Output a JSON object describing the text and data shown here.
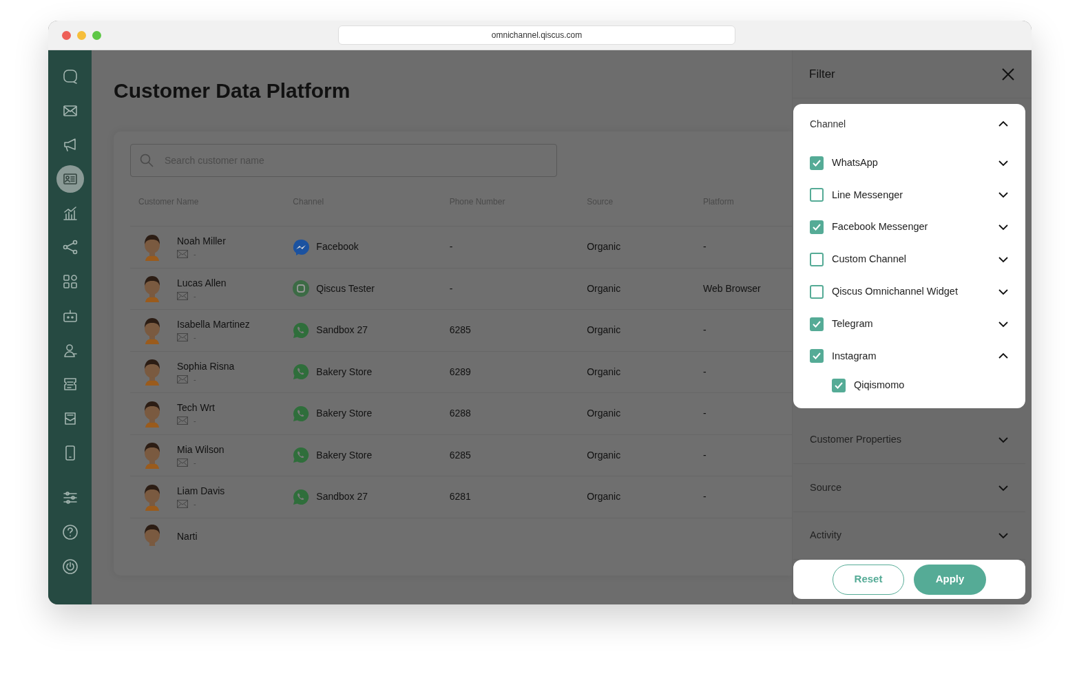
{
  "browser": {
    "url": "omnichannel.qiscus.com"
  },
  "sidebar": {
    "items": [
      {
        "selected": false
      },
      {
        "selected": false
      },
      {
        "selected": false
      },
      {
        "selected": true
      },
      {
        "selected": false
      },
      {
        "selected": false
      },
      {
        "selected": false
      },
      {
        "selected": false
      },
      {
        "selected": false
      },
      {
        "selected": false
      },
      {
        "selected": false
      },
      {
        "selected": false
      },
      {
        "selected": false
      },
      {
        "selected": false
      },
      {
        "selected": false
      }
    ]
  },
  "page": {
    "title": "Customer Data Platform"
  },
  "search": {
    "placeholder": "Search customer name"
  },
  "table": {
    "columns": [
      "Customer Name",
      "Channel",
      "Phone Number",
      "Source",
      "Platform"
    ],
    "rows": [
      {
        "name": "Noah Miller",
        "email": "-",
        "channel": {
          "kind": "messenger",
          "name": "Facebook"
        },
        "phone": "-",
        "source": "Organic",
        "platform": "-"
      },
      {
        "name": "Lucas Allen",
        "email": "-",
        "channel": {
          "kind": "qiscus",
          "name": "Qiscus Tester"
        },
        "phone": "-",
        "source": "Organic",
        "platform": "Web Browser"
      },
      {
        "name": "Isabella Martinez",
        "email": "-",
        "channel": {
          "kind": "whatsapp",
          "name": "Sandbox 27"
        },
        "phone": "6285",
        "source": "Organic",
        "platform": "-"
      },
      {
        "name": "Sophia Risna",
        "email": "-",
        "channel": {
          "kind": "whatsapp",
          "name": "Bakery Store"
        },
        "phone": "6289",
        "source": "Organic",
        "platform": "-"
      },
      {
        "name": "Tech Wrt",
        "email": "-",
        "channel": {
          "kind": "whatsapp",
          "name": "Bakery Store"
        },
        "phone": "6288",
        "source": "Organic",
        "platform": "-"
      },
      {
        "name": "Mia Wilson",
        "email": "-",
        "channel": {
          "kind": "whatsapp",
          "name": "Bakery Store"
        },
        "phone": "6285",
        "source": "Organic",
        "platform": "-"
      },
      {
        "name": "Liam Davis",
        "email": "-",
        "channel": {
          "kind": "whatsapp",
          "name": "Sandbox 27"
        },
        "phone": "6281",
        "source": "Organic",
        "platform": "-"
      },
      {
        "name": "Narti"
      }
    ]
  },
  "filter": {
    "title": "Filter",
    "sections": [
      {
        "label": "Channel",
        "expanded": true,
        "options": [
          {
            "label": "WhatsApp",
            "checked": true,
            "expanded": false
          },
          {
            "label": "Line Messenger",
            "checked": false,
            "expanded": false
          },
          {
            "label": "Facebook Messenger",
            "checked": true,
            "expanded": false
          },
          {
            "label": "Custom Channel",
            "checked": false,
            "expanded": false
          },
          {
            "label": "Qiscus Omnichannel Widget",
            "checked": false,
            "expanded": false
          },
          {
            "label": "Telegram",
            "checked": true,
            "expanded": false
          },
          {
            "label": "Instagram",
            "checked": true,
            "expanded": true,
            "children": [
              {
                "label": "Qiqismomo",
                "checked": true
              }
            ]
          }
        ]
      },
      {
        "label": "Customer Properties",
        "expanded": false
      },
      {
        "label": "Source",
        "expanded": false
      },
      {
        "label": "Activity",
        "expanded": false
      }
    ],
    "buttons": [
      {
        "label": "Reset",
        "kind": "outline"
      },
      {
        "label": "Apply",
        "kind": "primary"
      }
    ]
  }
}
